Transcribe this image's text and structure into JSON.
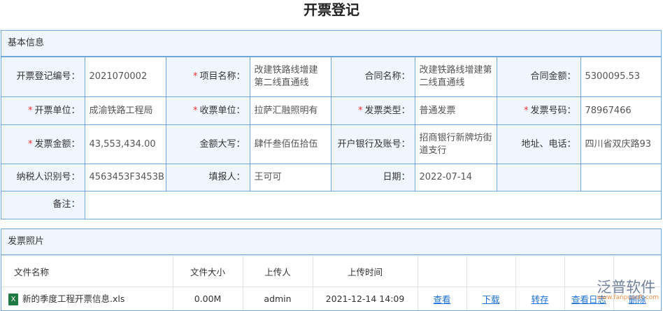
{
  "title": "开票登记",
  "basic": {
    "header": "基本信息",
    "rows": [
      [
        {
          "label": "开票登记编号：",
          "value": "2021070002",
          "req": false
        },
        {
          "label": "项目名称：",
          "value": "改建铁路线增建第二线直通线",
          "req": true
        },
        {
          "label": "合同名称：",
          "value": "改建铁路线增建第二线直通线",
          "req": false
        },
        {
          "label": "合同金额：",
          "value": "5300095.53",
          "req": false
        }
      ],
      [
        {
          "label": "开票单位：",
          "value": "成渝铁路工程局",
          "req": true
        },
        {
          "label": "收票单位：",
          "value": "拉萨汇融照明有",
          "req": true
        },
        {
          "label": "发票类型：",
          "value": "普通发票",
          "req": true
        },
        {
          "label": "发票号码：",
          "value": "78967466",
          "req": true
        }
      ],
      [
        {
          "label": "发票金额：",
          "value": "43,553,434.00",
          "req": true
        },
        {
          "label": "金额大写：",
          "value": "肆仟叁佰伍拾伍",
          "req": false
        },
        {
          "label": "开户银行及账号：",
          "value": "招商银行新牌坊街道支行",
          "req": false
        },
        {
          "label": "地址、电话：",
          "value": "四川省双庆路93",
          "req": false
        }
      ],
      [
        {
          "label": "纳税人识别号：",
          "value": "4563453F3453B",
          "req": false
        },
        {
          "label": "填报人：",
          "value": "王可可",
          "req": false
        },
        {
          "label": "日期：",
          "value": "2022-07-14",
          "req": false
        },
        {
          "label": "",
          "value": "",
          "req": false
        }
      ]
    ],
    "remark_label": "备注：",
    "remark_value": ""
  },
  "photos": {
    "header": "发票照片",
    "columns": [
      "文件名称",
      "文件大小",
      "上传人",
      "上传时间"
    ],
    "files": [
      {
        "name": "新的季度工程开票信息.xls",
        "size": "0.00M",
        "uploader": "admin",
        "time": "2021-12-14 14:09",
        "actions": [
          "查看",
          "下载",
          "转存",
          "查看日志",
          "删除"
        ]
      }
    ]
  },
  "watermark": {
    "text": "泛普软件",
    "sub": "www.fanpusoft.com"
  }
}
